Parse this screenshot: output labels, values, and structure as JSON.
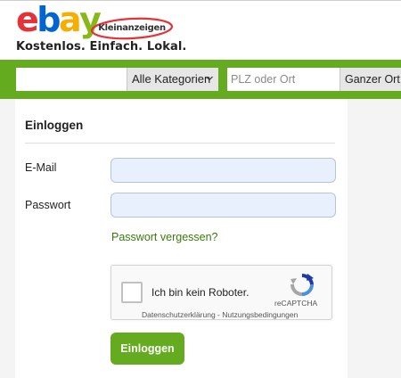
{
  "header": {
    "logo_ebay_letters": [
      "e",
      "b",
      "a",
      "y"
    ],
    "logo_ebay_colors": [
      "#e53238",
      "#0064d2",
      "#f5af02",
      "#86b817"
    ],
    "logo_kleinanzeigen": "Kleinanzeigen",
    "tagline": "Kostenlos. Einfach. Lokal."
  },
  "search": {
    "query_value": "",
    "category_selected": "Alle Kategorien",
    "location_placeholder": "PLZ oder Ort",
    "radius_selected": "Ganzer Ort"
  },
  "login": {
    "title": "Einloggen",
    "email_label": "E-Mail",
    "email_value": "",
    "password_label": "Passwort",
    "password_value": "",
    "forgot_link": "Passwort vergessen?",
    "submit_label": "Einloggen"
  },
  "captcha": {
    "label": "Ich bin kein Roboter.",
    "brand": "reCAPTCHA",
    "privacy_link": "Datenschutzerklärung",
    "separator": " - ",
    "terms_link": "Nutzungsbedingungen",
    "checked": false
  },
  "colors": {
    "brand_green": "#64ab1f",
    "link_green": "#3a7a0c",
    "autofill_blue": "#e8f0fe"
  }
}
